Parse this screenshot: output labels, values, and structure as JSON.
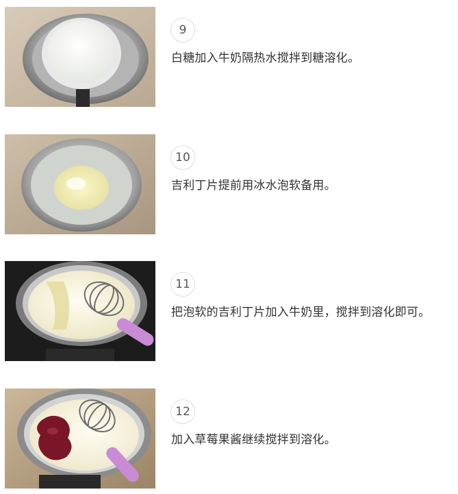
{
  "steps": [
    {
      "number": "9",
      "text": "白糖加入牛奶隔热水搅拌到糖溶化。",
      "photo_icon": "milk-bowl-in-water-bath"
    },
    {
      "number": "10",
      "text": "吉利丁片提前用冰水泡软备用。",
      "photo_icon": "gelatin-in-ice-water-bowl"
    },
    {
      "number": "11",
      "text": "把泡软的吉利丁片加入牛奶里，搅拌到溶化即可。",
      "photo_icon": "whisk-in-milk-pot"
    },
    {
      "number": "12",
      "text": "加入草莓果酱继续搅拌到溶化。",
      "photo_icon": "strawberry-jam-in-milk-pot"
    }
  ],
  "colors": {
    "text": "#333333",
    "number": "#555555",
    "circle_border": "#dcdcdc",
    "whisk_handle": "#c98bd6",
    "jam": "#7a1628"
  }
}
